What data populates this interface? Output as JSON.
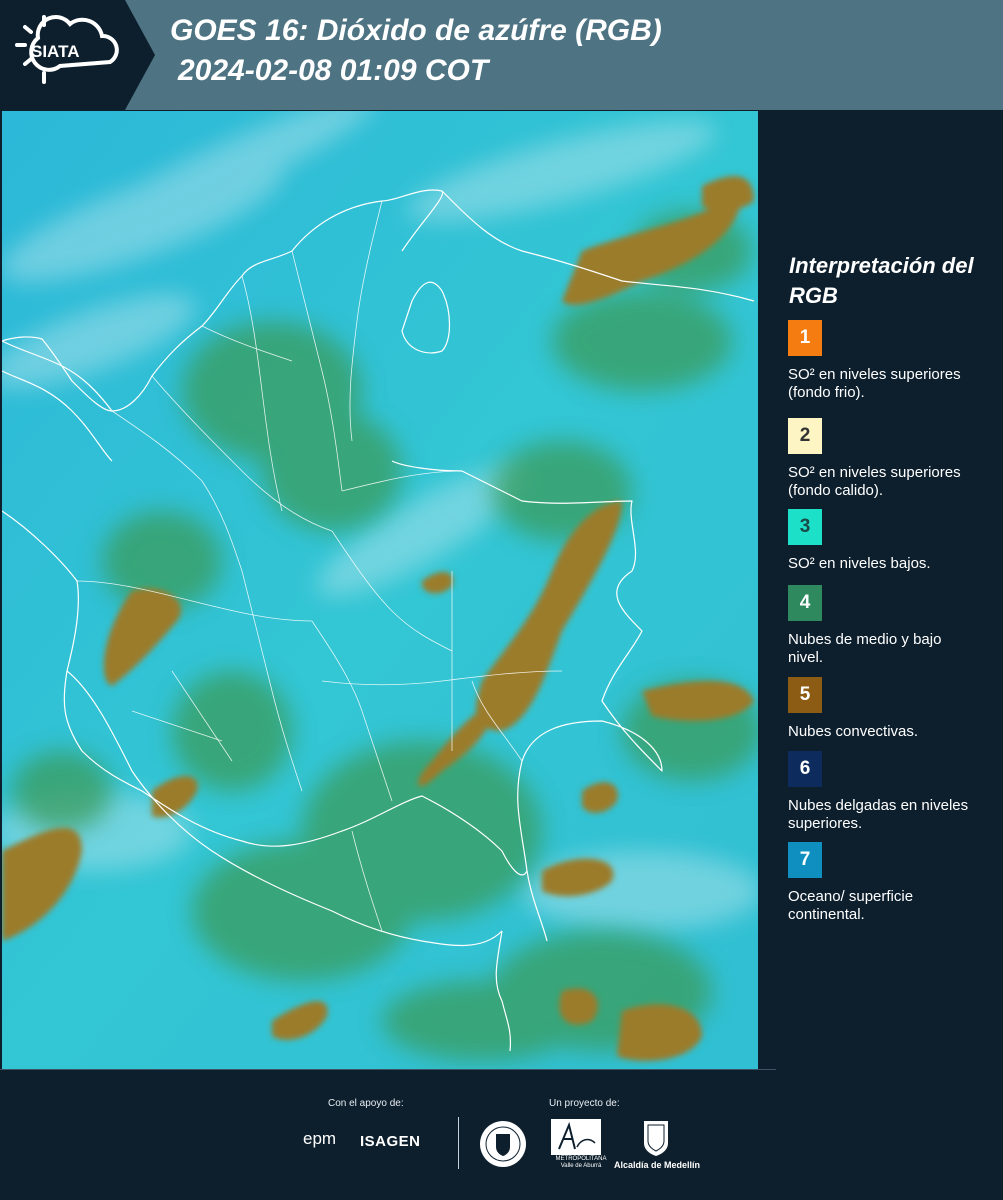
{
  "header": {
    "logo_text": "SIATA",
    "title_line1": "GOES 16: Dióxido de azúfre (RGB)",
    "title_line2": "2024-02-08 01:09 COT",
    "bar_color": "#4e7483",
    "logo_bg": "#0d1f2d"
  },
  "legend": {
    "title": "Interpretación del RGB",
    "items": [
      {
        "number": "1",
        "label": "SO² en niveles superiores (fondo frio).",
        "color": "#f47c10",
        "num_color": "#ffffff"
      },
      {
        "number": "2",
        "label": "SO² en niveles superiores (fondo calido).",
        "color": "#fdf5c3",
        "num_color": "#333333"
      },
      {
        "number": "3",
        "label": "SO² en niveles bajos.",
        "color": "#1de0c9",
        "num_color": "#1a4a46"
      },
      {
        "number": "4",
        "label": "Nubes de medio y bajo nivel.",
        "color": "#2e8a5e",
        "num_color": "#ffffff"
      },
      {
        "number": "5",
        "label": "Nubes convectivas.",
        "color": "#8c5c14",
        "num_color": "#ffffff"
      },
      {
        "number": "6",
        "label": "Nubes delgadas en niveles superiores.",
        "color": "#0d2b5c",
        "num_color": "#ffffff"
      },
      {
        "number": "7",
        "label": "Oceano/ superficie continental.",
        "color": "#0e8fc0",
        "num_color": "#ffffff"
      }
    ]
  },
  "footer": {
    "support_label": "Con el apoyo de:",
    "project_label": "Un proyecto de:",
    "sponsors": [
      "epm",
      "ISAGEN"
    ],
    "partners": [
      "Área Metropolitana Valle de Aburrá",
      "Alcaldía de Medellín"
    ],
    "amva_caption": "METROPOLITANA Valle de Aburrá",
    "alcaldia_caption": "Alcaldía de Medellín"
  },
  "map": {
    "ocean_color": "#2fc3d6",
    "land_color": "#35c6cf",
    "cloud_green": "#3b9f5e",
    "cloud_brown": "#9a7d2e",
    "border_color": "#ffffff"
  }
}
